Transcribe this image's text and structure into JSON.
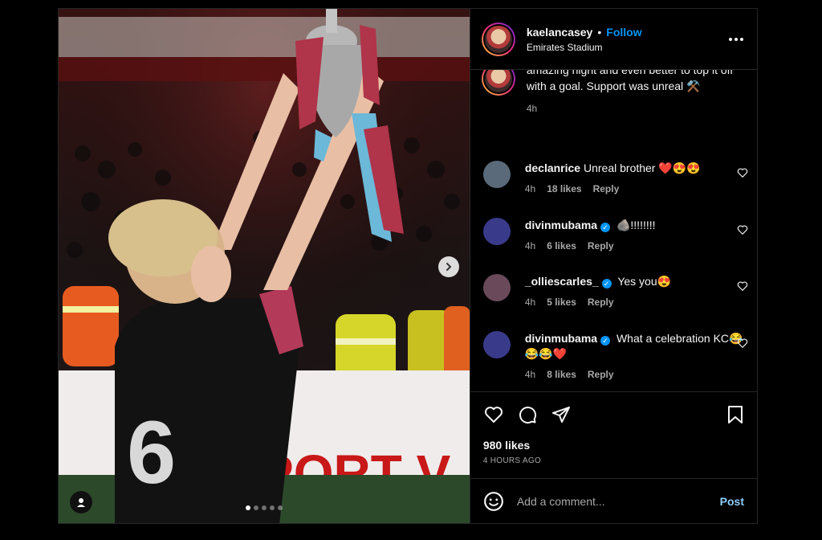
{
  "post": {
    "username": "kaelancasey",
    "separator": "•",
    "follow_label": "Follow",
    "location": "Emirates Stadium",
    "more_icon": "more-horizontal-icon",
    "caption": {
      "text": "amazing night and even better to top it off with a goal. Support was unreal ⚒️",
      "time": "4h"
    },
    "photo": {
      "banner_text": "PORT V",
      "shirt_number": "6",
      "carousel_total": 5,
      "carousel_active": 1
    },
    "comments": [
      {
        "username": "declanrice",
        "verified": false,
        "text": "Unreal brother ❤️😍😍",
        "time": "4h",
        "likes": "18 likes",
        "reply": "Reply",
        "avatar_color": "#5a6a7a"
      },
      {
        "username": "divinmubama",
        "verified": true,
        "text": "🪨!!!!!!!!",
        "time": "4h",
        "likes": "6 likes",
        "reply": "Reply",
        "avatar_color": "#3a3a8a"
      },
      {
        "username": "_olliescarles_",
        "verified": true,
        "text": "Yes you😍",
        "time": "4h",
        "likes": "5 likes",
        "reply": "Reply",
        "avatar_color": "#6a4a5a"
      },
      {
        "username": "divinmubama",
        "verified": true,
        "text": "What a celebration KC😂😂😂❤️",
        "time": "4h",
        "likes": "8 likes",
        "reply": "Reply",
        "avatar_color": "#3a3a8a"
      }
    ],
    "likes_count": "980 likes",
    "posted_time": "4 HOURS AGO",
    "add_comment_placeholder": "Add a comment...",
    "post_label": "Post",
    "colors": {
      "accent": "#0095f6",
      "post_disabled": "#8ecdf8",
      "heart_red": "#ed4956"
    }
  }
}
